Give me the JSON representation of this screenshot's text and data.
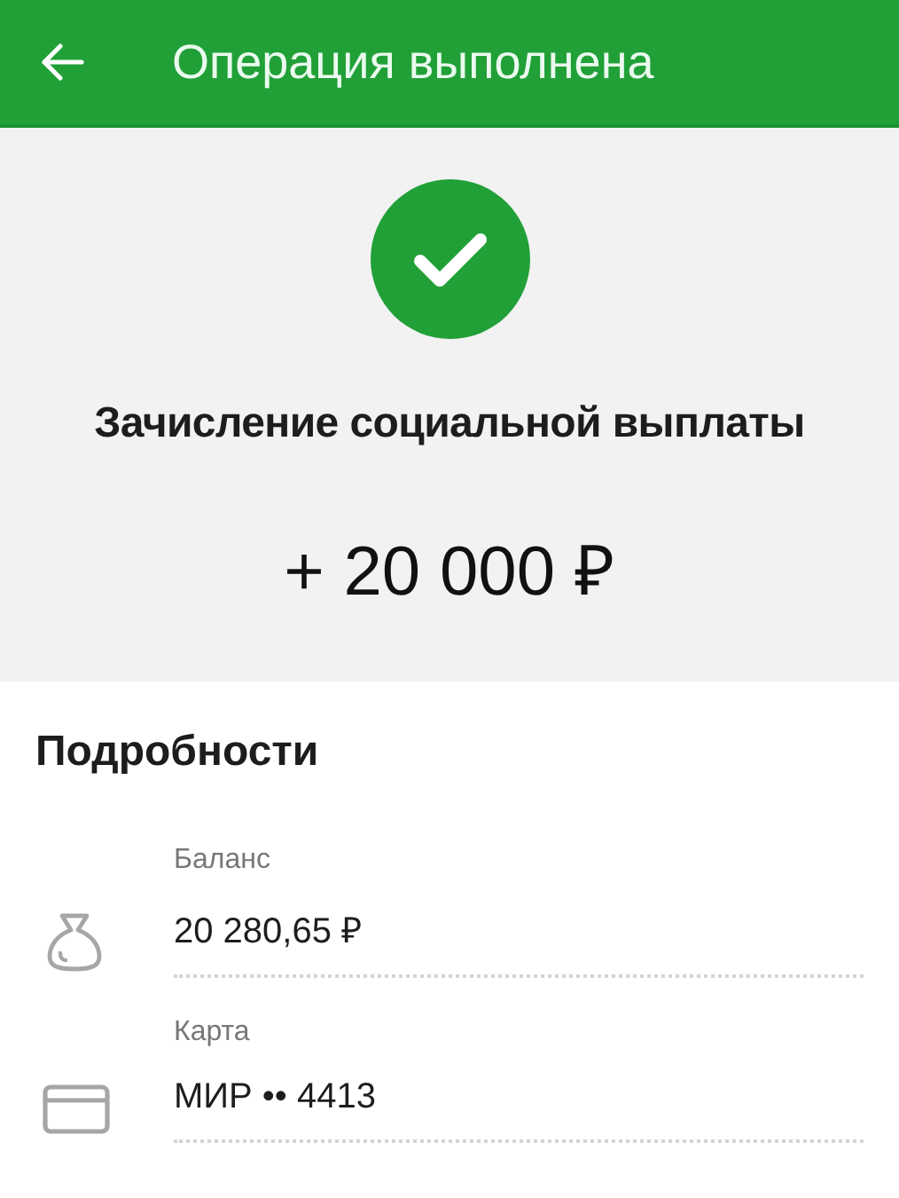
{
  "header": {
    "title": "Операция выполнена"
  },
  "status": {
    "kind": "success",
    "description": "Зачисление социальной выплаты",
    "amount": "+ 20 000 ₽"
  },
  "details": {
    "title": "Подробности",
    "items": [
      {
        "kind": "balance",
        "label": "Баланс",
        "value": "20 280,65 ₽"
      },
      {
        "kind": "card",
        "label": "Карта",
        "value": "МИР •• 4413"
      }
    ]
  }
}
